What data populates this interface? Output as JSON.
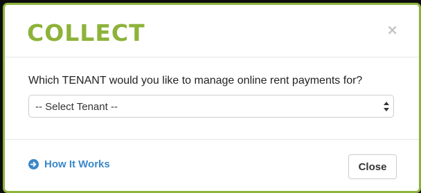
{
  "modal": {
    "title": "COLLECT",
    "close_icon_glyph": "×",
    "question": "Which TENANT would you like to manage online rent payments for?",
    "tenant_select": {
      "selected": "-- Select Tenant --",
      "options": [
        "-- Select Tenant --"
      ]
    },
    "how_it_works": {
      "label": "How It Works",
      "icon": "arrow-circle-right-icon"
    },
    "close_button_label": "Close"
  },
  "colors": {
    "brand_green": "#8db33a",
    "link_blue": "#3a87c8",
    "close_icon_gray": "#c4c4c4"
  }
}
